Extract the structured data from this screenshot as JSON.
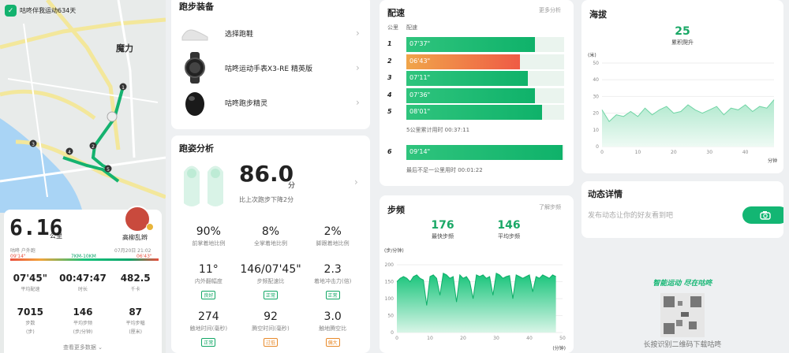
{
  "app": {
    "title": "咕咚伴我运动634天"
  },
  "map": {
    "place_label": "魔力",
    "markers": [
      "1",
      "2",
      "3",
      "4",
      "5"
    ]
  },
  "summary": {
    "distance": "6.16",
    "distance_unit": "公里",
    "user_name": "高柳乱辫",
    "sub_left": "咕咚 户外跑",
    "date": "07月20日 21:02",
    "pace_min": "09'14\"",
    "pace_mid": "7KM-10KM",
    "pace_max": "06'43\"",
    "row1": [
      {
        "value": "07'45\"",
        "label": "平均配速"
      },
      {
        "value": "00:47:47",
        "label": "时长"
      },
      {
        "value": "482.5",
        "label": "千卡"
      }
    ],
    "row2": [
      {
        "value": "7015",
        "label": "步数",
        "unit": "(步)"
      },
      {
        "value": "146",
        "label": "平均步频",
        "unit": "(步/分钟)"
      },
      {
        "value": "87",
        "label": "平均步幅",
        "unit": "(厘米)"
      }
    ],
    "more": "查看更多数据"
  },
  "gear": {
    "title": "跑步装备",
    "items": [
      {
        "label": "选择跑鞋",
        "icon": "shoe-icon"
      },
      {
        "label": "咕咚运动手表X3-RE 精英版",
        "icon": "watch-icon"
      },
      {
        "label": "咕咚跑步精灵",
        "icon": "sensor-icon"
      }
    ]
  },
  "posture": {
    "title": "跑姿分析",
    "score": "86.0",
    "score_unit": "分",
    "compare": "比上次跑步下降2分",
    "row1": [
      {
        "value": "90%",
        "label": "前掌着地比例"
      },
      {
        "value": "8%",
        "label": "全掌着地比例"
      },
      {
        "value": "2%",
        "label": "脚跟着地比例"
      }
    ],
    "row2": [
      {
        "value": "11°",
        "label": "内外翻幅度",
        "tag": "良好"
      },
      {
        "value": "146/07'45\"",
        "label": "步频配速比",
        "tag": "正常"
      },
      {
        "value": "2.3",
        "label": "着地冲击力(倍)",
        "tag": "正常"
      }
    ],
    "row3": [
      {
        "value": "274",
        "label": "触地时间(毫秒)",
        "tag": "正常"
      },
      {
        "value": "92",
        "label": "腾空时间(毫秒)",
        "tag": "过低"
      },
      {
        "value": "3.0",
        "label": "触地腾空比",
        "tag": "偏大"
      }
    ]
  },
  "pace": {
    "title": "配速",
    "more": "更多分析",
    "col_km": "公里",
    "col_pace": "配速",
    "rows": [
      {
        "km": "1",
        "pace": "07'37\"",
        "seconds": 457
      },
      {
        "km": "2",
        "pace": "06'43\"",
        "seconds": 403
      },
      {
        "km": "3",
        "pace": "07'11\"",
        "seconds": 431
      },
      {
        "km": "4",
        "pace": "07'36\"",
        "seconds": 456
      },
      {
        "km": "5",
        "pace": "08'01\"",
        "seconds": 481
      }
    ],
    "five_km_total": "5公里累计用时 00:37:11",
    "last": {
      "km": "6",
      "pace": "09'14\"",
      "seconds": 554
    },
    "last_note": "最后不足一公里用时 00:01:22"
  },
  "cadence": {
    "title": "步频",
    "more": "了解步频",
    "max_value": "176",
    "max_label": "最快步频",
    "avg_value": "146",
    "avg_label": "平均步频",
    "yunit": "(步/分钟)",
    "xunit": "(分钟)",
    "yticks": [
      "200",
      "150",
      "100",
      "50",
      "0"
    ],
    "xticks": [
      "0",
      "10",
      "20",
      "30",
      "40",
      "50"
    ]
  },
  "elevation": {
    "title": "海拔",
    "gain": "25",
    "gain_label": "累积爬升",
    "yunit": "(米)",
    "xunit": "分钟",
    "yticks": [
      "50",
      "40",
      "30",
      "20",
      "10",
      "0"
    ],
    "xticks": [
      "0",
      "10",
      "20",
      "30",
      "40"
    ]
  },
  "feed": {
    "title": "动态详情",
    "placeholder": "发布动态让你的好友看到吧"
  },
  "promo": {
    "slogan": "智能运动 尽在咕咚",
    "caption": "长按识别二维码下载咕咚"
  },
  "chart_data": [
    {
      "type": "area",
      "title": "步频",
      "xlabel": "(分钟)",
      "ylabel": "(步/分钟)",
      "xlim": [
        0,
        50
      ],
      "ylim": [
        0,
        200
      ],
      "x": [
        0,
        1,
        2,
        3,
        4,
        5,
        6,
        7,
        8,
        9,
        10,
        11,
        12,
        13,
        14,
        15,
        16,
        17,
        18,
        19,
        20,
        21,
        22,
        23,
        24,
        25,
        26,
        27,
        28,
        29,
        30,
        31,
        32,
        33,
        34,
        35,
        36,
        37,
        38,
        39,
        40,
        41,
        42,
        43,
        44,
        45,
        46,
        47,
        48
      ],
      "y": [
        150,
        160,
        165,
        160,
        150,
        165,
        170,
        160,
        155,
        80,
        165,
        170,
        160,
        110,
        175,
        170,
        160,
        165,
        90,
        170,
        160,
        165,
        150,
        100,
        170,
        165,
        170,
        160,
        165,
        110,
        175,
        170,
        160,
        165,
        168,
        100,
        170,
        165,
        160,
        165,
        170,
        120,
        165,
        160,
        170,
        165,
        160,
        170,
        165
      ]
    },
    {
      "type": "area",
      "title": "海拔",
      "xlabel": "分钟",
      "ylabel": "(米)",
      "xlim": [
        0,
        48
      ],
      "ylim": [
        0,
        50
      ],
      "x": [
        0,
        2,
        4,
        6,
        8,
        10,
        12,
        14,
        16,
        18,
        20,
        22,
        24,
        26,
        28,
        30,
        32,
        34,
        36,
        38,
        40,
        42,
        44,
        46,
        48
      ],
      "y": [
        22,
        15,
        19,
        18,
        21,
        18,
        23,
        19,
        22,
        24,
        20,
        21,
        25,
        22,
        20,
        22,
        24,
        19,
        23,
        22,
        25,
        21,
        24,
        23,
        28
      ]
    }
  ]
}
